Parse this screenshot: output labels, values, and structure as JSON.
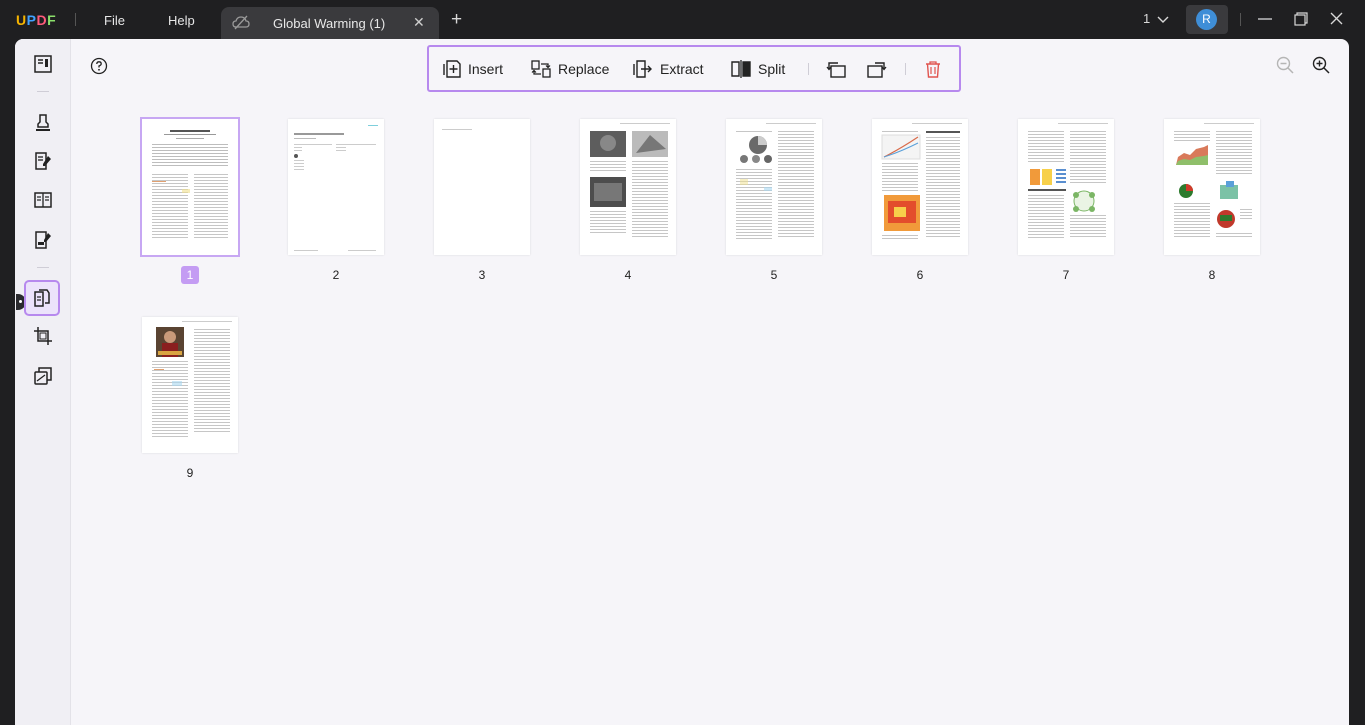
{
  "titlebar": {
    "logo": {
      "u": "U",
      "p": "P",
      "d": "D",
      "f": "F"
    },
    "menu": [
      "File",
      "Help"
    ],
    "tab_title": "Global Warming (1)",
    "tab_close": "✕",
    "new_tab": "+",
    "page_count": "1",
    "avatar_letter": "R"
  },
  "toolbar": {
    "insert": "Insert",
    "replace": "Replace",
    "extract": "Extract",
    "split": "Split"
  },
  "pages": [
    "1",
    "2",
    "3",
    "4",
    "5",
    "6",
    "7",
    "8",
    "9"
  ],
  "colors": {
    "accent": "#b789ee",
    "selected_label": "#c49cf3",
    "delete_red": "#e0544f"
  }
}
